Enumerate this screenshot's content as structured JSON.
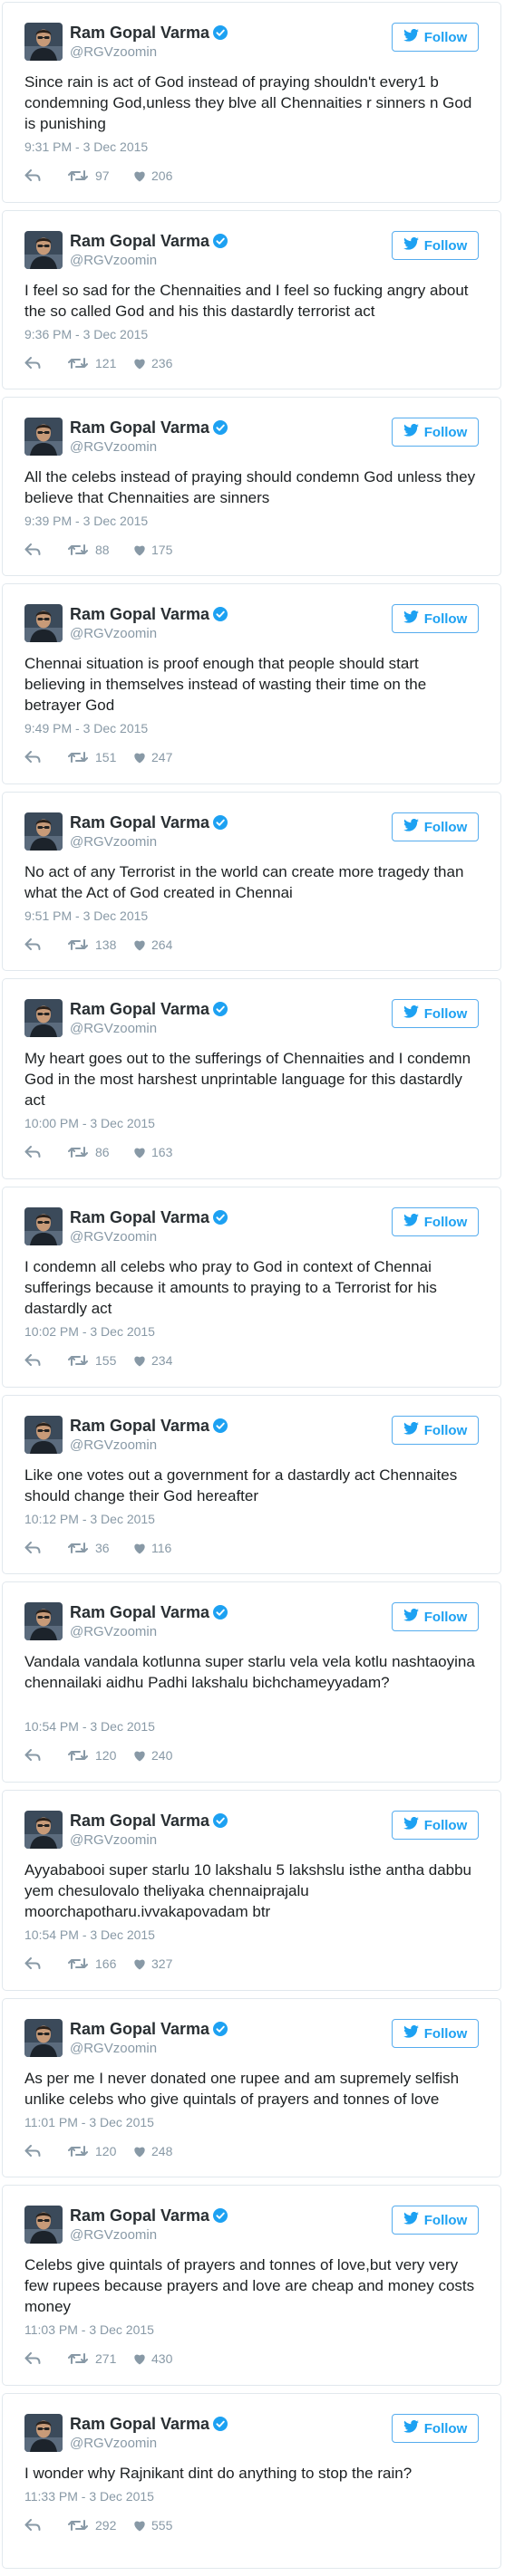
{
  "author": {
    "name": "Ram Gopal Varma",
    "handle": "@RGVzoomin"
  },
  "follow_label": "Follow",
  "icons": {
    "avatar": "profile-photo",
    "verified": "verified-badge-icon",
    "bird": "twitter-bird-icon",
    "reply": "reply-icon",
    "retweet": "retweet-icon",
    "like": "heart-icon"
  },
  "colors": {
    "accent": "#1da1f2",
    "muted": "#8899a6",
    "border": "#e1e8ed"
  },
  "tweets": [
    {
      "text": "Since rain is act of God instead of praying shouldn't every1 b condemning God,unless they blve all Chennaities r sinners n God is punishing",
      "time": "9:31 PM - 3 Dec 2015",
      "retweets": "97",
      "likes": "206"
    },
    {
      "text": "I feel so sad for the Chennaities and I feel so fucking angry about the so called God and his this dastardly terrorist act",
      "time": "9:36 PM - 3 Dec 2015",
      "retweets": "121",
      "likes": "236"
    },
    {
      "text": "All the celebs instead of praying should condemn God unless they believe that Chennaities are sinners",
      "time": "9:39 PM - 3 Dec 2015",
      "retweets": "88",
      "likes": "175"
    },
    {
      "text": "Chennai situation is proof enough that people should start believing in themselves instead of wasting their time on the betrayer God",
      "time": "9:49 PM - 3 Dec 2015",
      "retweets": "151",
      "likes": "247"
    },
    {
      "text": "No act of any Terrorist in the world can create more tragedy than what the Act of God created in Chennai",
      "time": "9:51 PM - 3 Dec 2015",
      "retweets": "138",
      "likes": "264"
    },
    {
      "text": "My heart goes out to the sufferings of Chennaities and I condemn God in the most harshest unprintable language for this dastardly act",
      "time": "10:00 PM - 3 Dec 2015",
      "retweets": "86",
      "likes": "163"
    },
    {
      "text": "I condemn all celebs who pray to God in context of Chennai sufferings because it amounts to praying to a Terrorist for his dastardly act",
      "time": "10:02 PM - 3 Dec 2015",
      "retweets": "155",
      "likes": "234"
    },
    {
      "text": "Like one votes out a government for a dastardly act Chennaites should change their God hereafter",
      "time": "10:12 PM - 3 Dec 2015",
      "retweets": "36",
      "likes": "116"
    },
    {
      "text": "Vandala vandala kotlunna super starlu vela vela kotlu nashtaoyina chennailaki aidhu Padhi lakshalu bichchameyyadam?",
      "time": "10:54 PM - 3 Dec 2015",
      "retweets": "120",
      "likes": "240"
    },
    {
      "text": "Ayyababooi super starlu 10 lakshalu 5 lakshslu isthe antha dabbu yem chesulovalo theliyaka chennaiprajalu moorchapotharu.ivvakapovadam btr",
      "time": "10:54 PM - 3 Dec 2015",
      "retweets": "166",
      "likes": "327"
    },
    {
      "text": "As per me I never donated one rupee and am supremely selfish unlike celebs who give quintals of prayers and tonnes of love",
      "time": "11:01 PM - 3 Dec 2015",
      "retweets": "120",
      "likes": "248"
    },
    {
      "text": "Celebs give quintals of prayers and tonnes of love,but very very few rupees because prayers and love are cheap and money costs money",
      "time": "11:03 PM - 3 Dec 2015",
      "retweets": "271",
      "likes": "430"
    },
    {
      "text": "I wonder why Rajnikant dint do anything to stop the rain?",
      "time": "11:33 PM - 3 Dec 2015",
      "retweets": "292",
      "likes": "555"
    }
  ]
}
